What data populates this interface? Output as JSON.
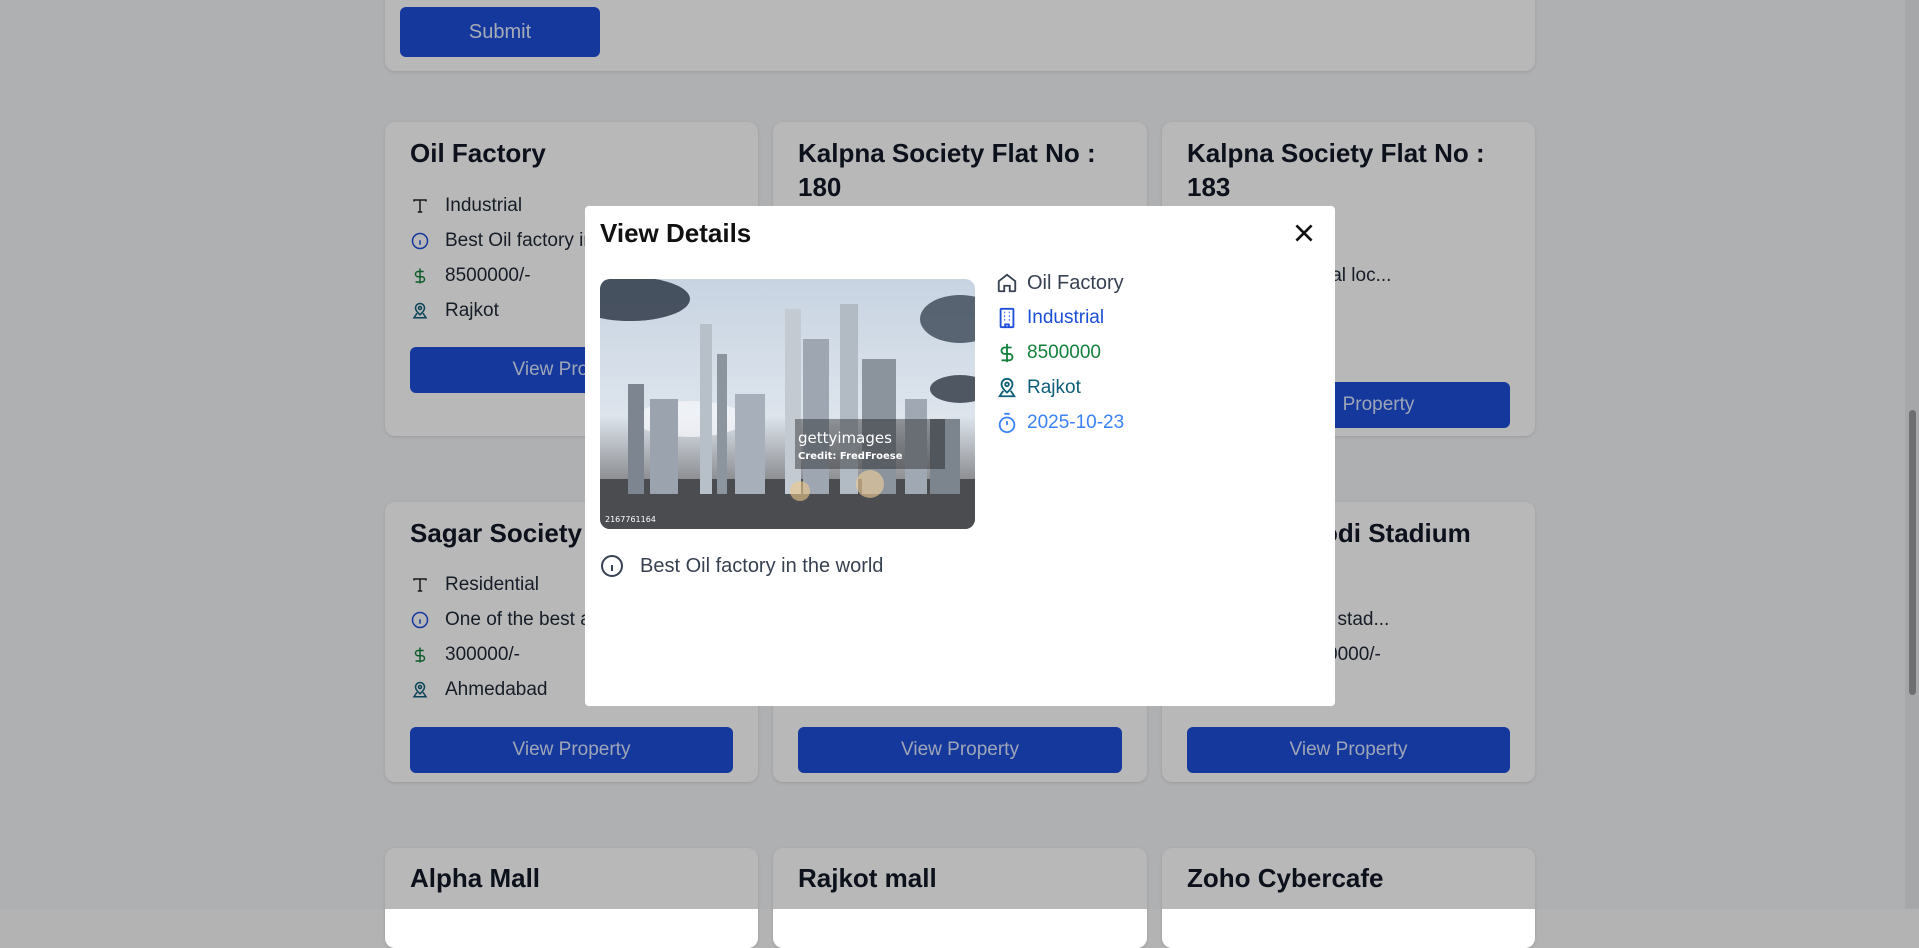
{
  "form": {
    "submit_label": "Submit"
  },
  "cards": [
    {
      "title": "Oil Factory",
      "type": "Industrial",
      "description": "Best Oil factory in",
      "price": "8500000/-",
      "location": "Rajkot",
      "button": "View Property"
    },
    {
      "title": "Kalpna Society Flat No : 180"
    },
    {
      "title": "Kalpna Society Flat No : 183",
      "description": "ial loc...",
      "button": "Property"
    },
    {
      "title": "Sagar Society H",
      "type": "Residential",
      "description": "One of the best a",
      "price": "300000/-",
      "location": "Ahmedabad",
      "button": "View Property"
    },
    {
      "button": "View Property"
    },
    {
      "title": "odi Stadium",
      "description": "t stad...",
      "price": "0000/-",
      "button": "View Property"
    },
    {
      "title": "Alpha Mall"
    },
    {
      "title": "Rajkot mall"
    },
    {
      "title": "Zoho Cybercafe"
    }
  ],
  "modal": {
    "title": "View Details",
    "name": "Oil Factory",
    "type": "Industrial",
    "price": "8500000",
    "location": "Rajkot",
    "date": "2025-10-23",
    "description": "Best Oil factory in the world",
    "image_watermark": "gettyimages",
    "image_credit": "Credit: FredFroese",
    "image_id": "2167761164"
  },
  "colors": {
    "primary": "#1d4ed8",
    "price_green": "#15803d",
    "location_teal": "#0f5e7a",
    "date_blue": "#3b82f6"
  }
}
